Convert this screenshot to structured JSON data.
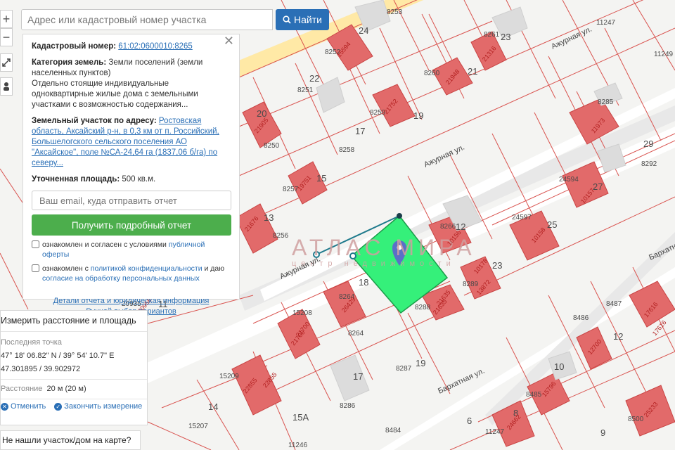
{
  "search": {
    "placeholder": "Адрес или кадастровый номер участка",
    "button_label": "Найти"
  },
  "controls": {
    "zoom_in": "+",
    "zoom_out": "−"
  },
  "info": {
    "cad_label": "Кадастровый номер:",
    "cad_value": "61:02:0600010:8265",
    "category_label": "Категория земель:",
    "category_value": "Земли поселений (земли населенных пунктов)",
    "usage": "Отдельно стоящие индивидуальные одноквартирные жилые дома с земельными участками с возможностью содержания...",
    "address_label": "Земельный участок по адресу:",
    "address_value": "Ростовская область, Аксайский р-н, в 0,3 км от п. Российский, Большелогского сельского поселения АО \"Аксайское\", поле №СА-24,64 га (1837,06 б/га) по северу...",
    "area_label": "Уточненная площадь:",
    "area_value": "500 кв.м.",
    "email_placeholder": "Ваш email, куда отправить отчет",
    "report_button": "Получить подробный отчет",
    "consent1_text": "ознакомлен и согласен с условиями ",
    "consent1_link": "публичной оферты",
    "consent2_text": "ознакомлен с ",
    "consent2_link": "политикой конфиденциальности",
    "consent2_mid": " и даю ",
    "consent2_link2": "согласие на обработку персональных данных",
    "link_details": "Детали отчета и юридическая информация",
    "link_manual": "Ручной выбор вариантов"
  },
  "measure": {
    "title": "Измерить расстояние и площадь",
    "last_point_label": "Последняя точка",
    "coords_dms": "47° 18' 06.82\" N / 39° 54' 10.7\" E",
    "coords_dec": "47.301895 / 39.902972",
    "distance_label": "Расстояние",
    "distance_value": "20 м (20 м)",
    "cancel": "Отменить",
    "finish": "Закончить измерение"
  },
  "notfound": "Не нашли участок/дом на карте?",
  "map": {
    "streets": [
      "Ажурная ул.",
      "Ажурная ул.",
      "Бархатная ул.",
      "Бархатная ул.",
      "Ажурная ул."
    ],
    "watermark": "АТЛАС МИРА",
    "watermark_sub": "центр недвижимости",
    "parcel_labels": [
      "8253",
      "24",
      "8252",
      "8261",
      "23",
      "11247",
      "11249",
      "22",
      "8251",
      "8260",
      "21",
      "8285",
      "8259",
      "19",
      "20",
      "8250",
      "17",
      "8258",
      "29",
      "8292",
      "8257",
      "15",
      "24594",
      "27",
      "13",
      "8256",
      "8266",
      "12",
      "24597",
      "25",
      "23",
      "18",
      "8264",
      "8288",
      "8289",
      "20935",
      "11",
      "15208",
      "8487",
      "8486",
      "8264",
      "12",
      "8287",
      "19",
      "15209",
      "17",
      "10",
      "8485",
      "8286",
      "14",
      "15A",
      "8484",
      "11247",
      "8",
      "8500",
      "15207",
      "11246",
      "6",
      "9"
    ],
    "building_labels": [
      "15594",
      "21316",
      "21948",
      "21752",
      "11973",
      "21905",
      "19751",
      "21676",
      "20958",
      "10157",
      "10158",
      "10156",
      "10178",
      "26429",
      "21635",
      "21635",
      "21700",
      "21700",
      "17616",
      "17616",
      "12700",
      "22855",
      "22855",
      "15796",
      "24662",
      "25233",
      "13872"
    ]
  },
  "colors": {
    "accent": "#2a6fb6",
    "green_button": "#4cae4c",
    "selected_parcel": "#35f07a",
    "parcel_border": "#d9534f",
    "building_fill": "#e26a6a",
    "road": "#ffffff"
  }
}
